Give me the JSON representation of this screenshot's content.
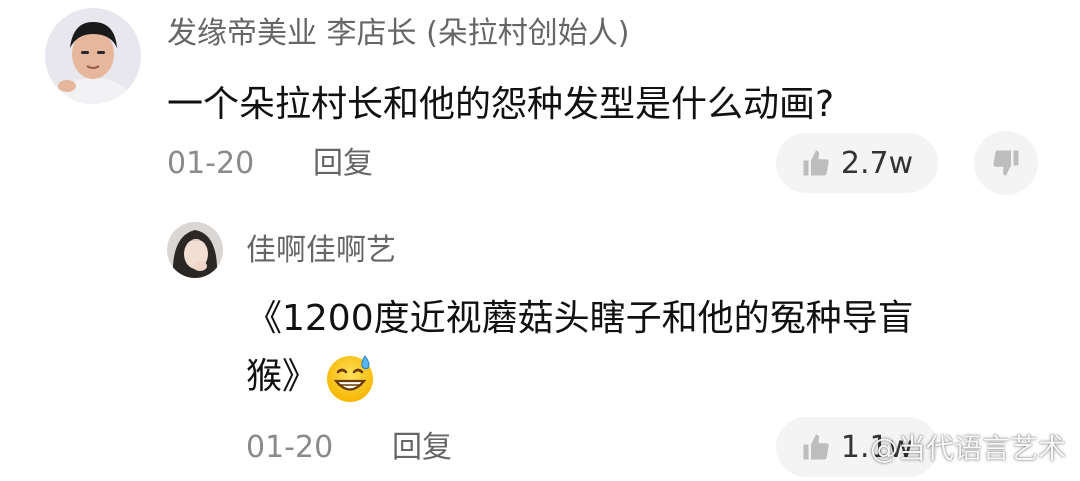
{
  "comment": {
    "author": "发缘帝美业 李店长 (朵拉村创始人)",
    "text": "一个朵拉村长和他的怨种发型是什么动画?",
    "date": "01-20",
    "reply_label": "回复",
    "like_count": "2.7w",
    "icons": {
      "like": "thumbs-up-icon",
      "dislike": "thumbs-down-icon"
    }
  },
  "reply": {
    "author": "佳啊佳啊艺",
    "text_line1": "《1200度近视蘑菇头瞎子和他的冤种导盲",
    "text_line2": "猴》",
    "emoji": "grinning-sweat-emoji",
    "date": "01-20",
    "reply_label": "回复",
    "like_count": "1.1w",
    "icons": {
      "like": "thumbs-up-icon"
    }
  },
  "watermark": {
    "text": "@当代语言艺术"
  },
  "colors": {
    "name": "#666666",
    "text": "#111111",
    "meta": "#8a8a8a",
    "pill_bg": "#f4f4f4"
  }
}
